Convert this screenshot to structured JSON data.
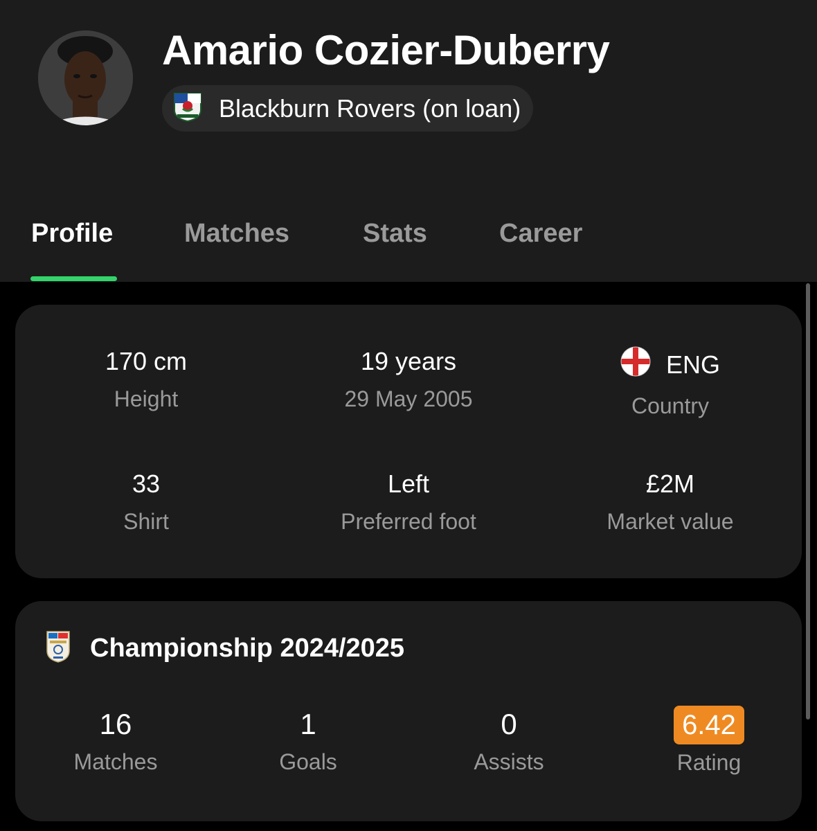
{
  "player": {
    "name": "Amario Cozier-Duberry",
    "club": "Blackburn Rovers (on loan)"
  },
  "tabs": [
    {
      "label": "Profile",
      "active": true
    },
    {
      "label": "Matches",
      "active": false
    },
    {
      "label": "Stats",
      "active": false
    },
    {
      "label": "Career",
      "active": false
    }
  ],
  "info": {
    "height": {
      "value": "170 cm",
      "label": "Height"
    },
    "age": {
      "value": "19 years",
      "label": "29 May 2005"
    },
    "country": {
      "value": "ENG",
      "label": "Country",
      "flag_icon": "england-flag-icon"
    },
    "shirt": {
      "value": "33",
      "label": "Shirt"
    },
    "foot": {
      "value": "Left",
      "label": "Preferred foot"
    },
    "market": {
      "value": "£2M",
      "label": "Market value"
    }
  },
  "season": {
    "title": "Championship 2024/2025",
    "logo_icon": "efl-championship-logo-icon",
    "stats": [
      {
        "value": "16",
        "label": "Matches"
      },
      {
        "value": "1",
        "label": "Goals"
      },
      {
        "value": "0",
        "label": "Assists"
      },
      {
        "value": "6.42",
        "label": "Rating"
      }
    ],
    "rating_color": "#ef8a22"
  },
  "colors": {
    "accent": "#34d36b",
    "card_bg": "#1c1c1c",
    "page_bg": "#000000",
    "muted_text": "#9a9a9a"
  }
}
